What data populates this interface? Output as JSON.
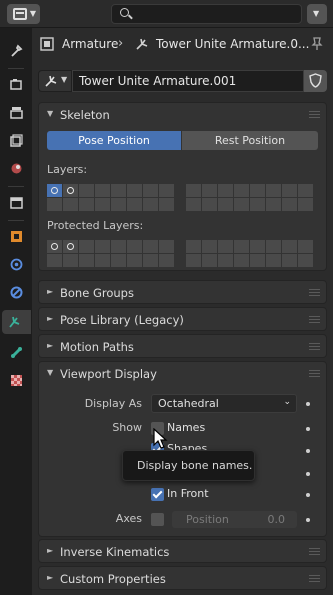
{
  "topbar": {
    "editor_icon": "properties-editor-icon",
    "search_icon": "search-icon",
    "menu_icon": "chevron-down-icon"
  },
  "tabs": [
    {
      "icon": "tool-icon"
    },
    {
      "icon": "render-icon"
    },
    {
      "icon": "output-icon"
    },
    {
      "icon": "view-layer-icon"
    },
    {
      "icon": "scene-icon"
    },
    {
      "icon": "world-icon"
    },
    {
      "icon": "collection-icon"
    },
    {
      "icon": "object-icon"
    },
    {
      "icon": "modifier-icon"
    },
    {
      "icon": "physics-icon"
    },
    {
      "icon": "armature-data-icon",
      "active": true
    },
    {
      "icon": "bone-icon"
    },
    {
      "icon": "texture-icon"
    }
  ],
  "breadcrumb": {
    "first": "Armature",
    "second": "Tower Unite Armature.0..."
  },
  "datablock": {
    "name": "Tower Unite Armature.001"
  },
  "skeleton": {
    "title": "Skeleton",
    "pose_position": "Pose Position",
    "rest_position": "Rest Position",
    "layers_label": "Layers:",
    "protected_label": "Protected Layers:"
  },
  "panels": {
    "bone_groups": "Bone Groups",
    "pose_library": "Pose Library (Legacy)",
    "motion_paths": "Motion Paths",
    "viewport_display": "Viewport Display",
    "inverse_kinematics": "Inverse Kinematics",
    "custom_properties": "Custom Properties"
  },
  "viewport": {
    "display_as_label": "Display As",
    "display_as_value": "Octahedral",
    "show_label": "Show",
    "names": "Names",
    "names_checked": false,
    "shapes": "Shapes",
    "shapes_checked": true,
    "in_front": "In Front",
    "in_front_checked": true,
    "axes_label": "Axes",
    "axes_checked": false,
    "position_label": "Position",
    "position_value": "0.0"
  },
  "tooltip": "Display bone names.",
  "colors": {
    "accent": "#4772b3",
    "panel": "#333333",
    "background": "#2b2b2b",
    "armature": "#3ab19a"
  }
}
